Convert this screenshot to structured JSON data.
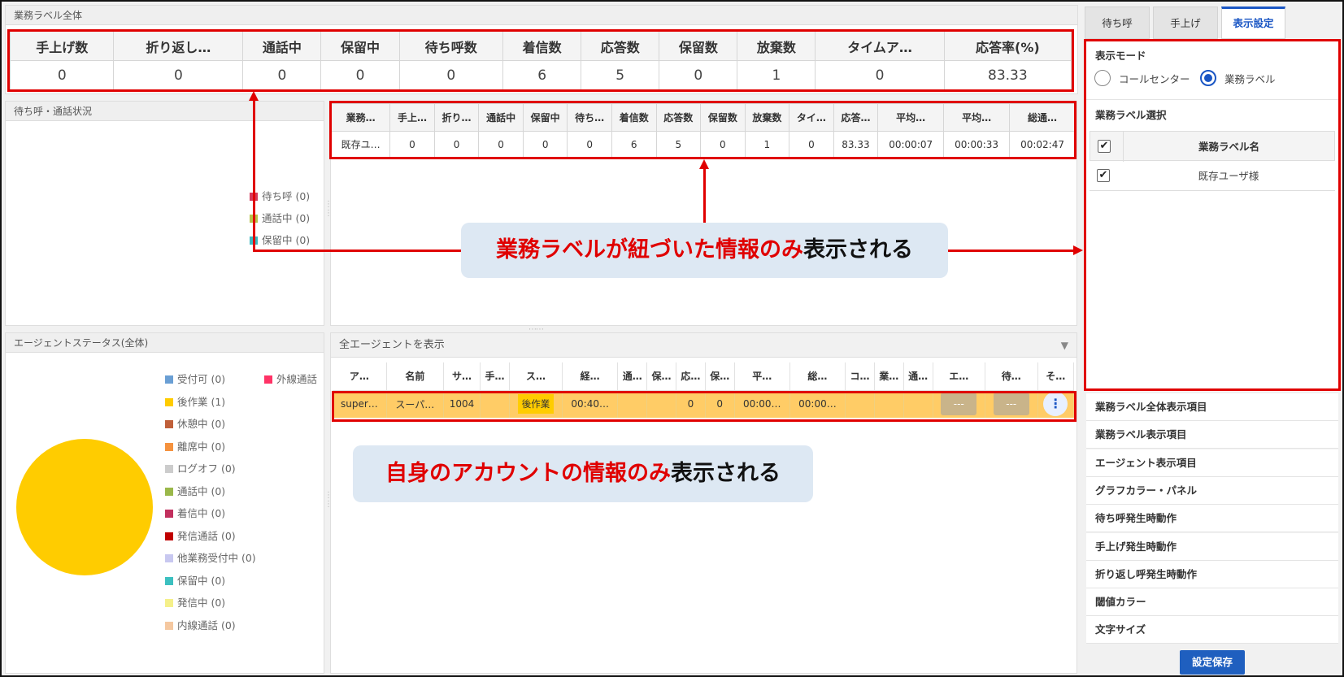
{
  "summary": {
    "title": "業務ラベル全体",
    "headers": [
      "手上げ数",
      "折り返し…",
      "通話中",
      "保留中",
      "待ち呼数",
      "着信数",
      "応答数",
      "保留数",
      "放棄数",
      "タイムア…",
      "応答率(%)"
    ],
    "values": [
      "0",
      "0",
      "0",
      "0",
      "0",
      "6",
      "5",
      "0",
      "1",
      "0",
      "83.33"
    ]
  },
  "waiting_panel": {
    "title": "待ち呼・通話状況",
    "legend": [
      {
        "label": "待ち呼 (0)",
        "color": "#d63a5b"
      },
      {
        "label": "通話中 (0)",
        "color": "#b8c24a"
      },
      {
        "label": "保留中 (0)",
        "color": "#3cb8c0"
      }
    ]
  },
  "label_table": {
    "headers": [
      "業務…",
      "手上…",
      "折り…",
      "通話中",
      "保留中",
      "待ち…",
      "着信数",
      "応答数",
      "保留数",
      "放棄数",
      "タイ…",
      "応答…",
      "平均…",
      "平均…",
      "総通…"
    ],
    "row": [
      "既存ユ…",
      "0",
      "0",
      "0",
      "0",
      "0",
      "6",
      "5",
      "0",
      "1",
      "0",
      "83.33",
      "00:00:07",
      "00:00:33",
      "00:02:47"
    ]
  },
  "callouts": {
    "top": {
      "highlight": "業務ラベルが紐づいた情報のみ",
      "rest": "表示される"
    },
    "bottom": {
      "highlight": "自身のアカウントの情報のみ",
      "rest": "表示される"
    }
  },
  "agent_status_panel": {
    "title": "エージェントステータス(全体)",
    "legend_col1": [
      {
        "label": "受付可 (0)",
        "color": "#6a9fd4"
      },
      {
        "label": "後作業 (1)",
        "color": "#ffcc00"
      },
      {
        "label": "休憩中 (0)",
        "color": "#c0603a"
      },
      {
        "label": "離席中 (0)",
        "color": "#f5923e"
      },
      {
        "label": "ログオフ (0)",
        "color": "#cccccc"
      },
      {
        "label": "通話中 (0)",
        "color": "#9ab84a"
      },
      {
        "label": "着信中 (0)",
        "color": "#c2305e"
      },
      {
        "label": "発信通話 (0)",
        "color": "#c00000"
      },
      {
        "label": "他業務受付中 (0)",
        "color": "#c8c8f0"
      },
      {
        "label": "保留中 (0)",
        "color": "#3cc0c0"
      },
      {
        "label": "発信中 (0)",
        "color": "#f5f08a"
      },
      {
        "label": "内線通話 (0)",
        "color": "#f5c8a0"
      }
    ],
    "legend_col2": [
      {
        "label": "外線通話",
        "color": "#ff3366"
      }
    ],
    "pie_color": "#ffcc00"
  },
  "agent_filter": {
    "selected": "全エージェントを表示"
  },
  "agent_table": {
    "headers": [
      "ア…",
      "名前",
      "サ…",
      "手…",
      "ス…",
      "経…",
      "通…",
      "保…",
      "応…",
      "保…",
      "平…",
      "総…",
      "コ…",
      "業…",
      "通…",
      "エ…",
      "待…",
      "そ…"
    ],
    "row": {
      "account": "super…",
      "name": "スーパ…",
      "sub": "1004",
      "hand": "",
      "status": "後作業",
      "elapsed": "00:40…",
      "calls": "",
      "hold": "",
      "answered": "0",
      "held": "0",
      "avg": "00:00…",
      "total": "00:00…",
      "btn1": "---",
      "btn2": "---",
      "menu": "⋮"
    }
  },
  "right_panel": {
    "tabs": [
      "待ち呼",
      "手上げ",
      "表示設定"
    ],
    "display_mode_title": "表示モード",
    "mode_options": [
      "コールセンター",
      "業務ラベル"
    ],
    "label_select_title": "業務ラベル選択",
    "label_table_header": "業務ラベル名",
    "label_table_row": "既存ユーザ様",
    "sections": [
      "業務ラベル全体表示項目",
      "業務ラベル表示項目",
      "エージェント表示項目",
      "グラフカラー・パネル",
      "待ち呼発生時動作",
      "手上げ発生時動作",
      "折り返し呼発生時動作",
      "閾値カラー",
      "文字サイズ"
    ],
    "save_label": "設定保存"
  },
  "colors": {
    "accent": "#1a56c4",
    "annotation_red": "#e00000",
    "agent_row": "#ffcc66",
    "callout_bg": "#dde8f3"
  }
}
